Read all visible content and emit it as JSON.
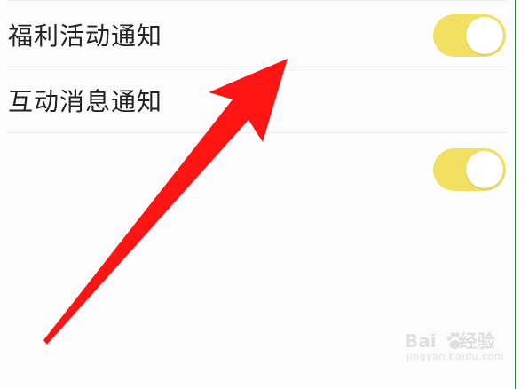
{
  "colors": {
    "toggle_on": "#f2e063",
    "arrow": "#ff1414",
    "frame_border": "#2e7d32"
  },
  "settings": {
    "items": [
      {
        "label": "福利活动通知",
        "state": "on"
      },
      {
        "label": "互动消息通知",
        "state": "on"
      }
    ]
  },
  "annotation": {
    "icon": "arrow-icon"
  },
  "watermark": {
    "logo_text": "Bai",
    "logo_text_2": "经验",
    "site": "jingyan.baidu.com"
  }
}
